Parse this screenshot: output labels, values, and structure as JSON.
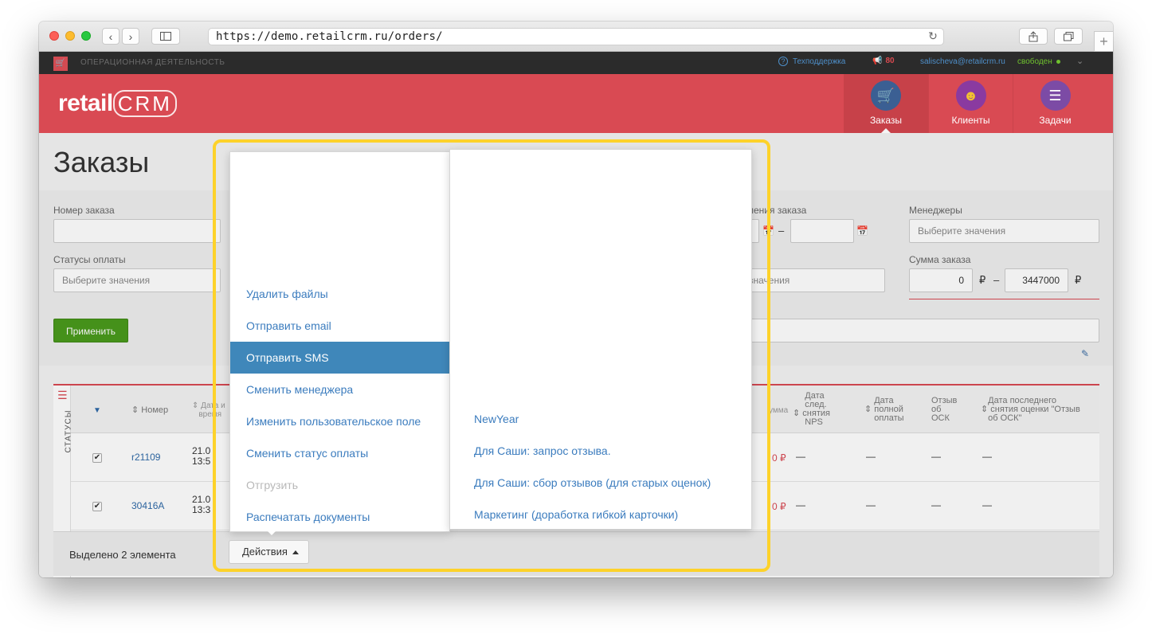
{
  "browser": {
    "url": "https://demo.retailcrm.ru/orders/"
  },
  "topbar": {
    "section_title": "ОПЕРАЦИОННАЯ ДЕЯТЕЛЬНОСТЬ",
    "support_label": "Техподдержка",
    "notifications_count": "80",
    "user_email": "salischeva@retailcrm.ru",
    "user_status": "свободен"
  },
  "header": {
    "logo_text": "retail",
    "logo_crm": "CRM",
    "nav": [
      {
        "label": "Заказы",
        "icon": "cart-icon",
        "active": true
      },
      {
        "label": "Клиенты",
        "icon": "user-icon",
        "active": false
      },
      {
        "label": "Задачи",
        "icon": "tasks-icon",
        "active": false
      }
    ]
  },
  "page": {
    "title": "Заказы"
  },
  "filters": {
    "order_number_label": "Номер заказа",
    "date_label_fragment": "ления заказа",
    "managers_label": "Менеджеры",
    "managers_placeholder": "Выберите значения",
    "payment_status_label": "Статусы оплаты",
    "payment_status_placeholder": "Выберите значения",
    "mid_placeholder_fragment": "значения",
    "sum_label": "Сумма заказа",
    "sum_from": "0",
    "sum_to": "3447000",
    "currency": "₽",
    "dash": "–",
    "apply_label": "Применить"
  },
  "table": {
    "side_label": "СТАТУСЫ",
    "headers": {
      "number": "Номер",
      "date_frag_1": "Дата и",
      "date_frag_2": "время",
      "sum_frag": "умма",
      "nps_1": "Дата",
      "nps_2": "след.",
      "nps_3": "снятия",
      "nps_4": "NPS",
      "pay_1": "Дата",
      "pay_2": "полной",
      "pay_3": "оплаты",
      "osk_1": "Отзыв",
      "osk_2": "об",
      "osk_3": "ОСК",
      "last_1": "Дата последнего",
      "last_2": "снятия оценки \"Отзыв",
      "last_3": "об ОСК\""
    },
    "rows": [
      {
        "number": "r21109",
        "date1": "21.0",
        "date2": "13:5",
        "sum": "0 ₽",
        "nps": "—",
        "pay": "—",
        "osk": "—",
        "last": "—",
        "checked": true
      },
      {
        "number": "30416A",
        "date1": "21.0",
        "date2": "13:3",
        "sum": "0 ₽",
        "nps": "—",
        "pay": "—",
        "osk": "—",
        "last": "—",
        "checked": true
      }
    ]
  },
  "selection": {
    "text": "Выделено 2 элемента"
  },
  "actions_menu": {
    "button_label": "Действия",
    "items": [
      {
        "label": "Удалить файлы",
        "state": "normal"
      },
      {
        "label": "Отправить email",
        "state": "normal"
      },
      {
        "label": "Отправить SMS",
        "state": "active"
      },
      {
        "label": "Сменить менеджера",
        "state": "normal"
      },
      {
        "label": "Изменить пользовательское поле",
        "state": "normal"
      },
      {
        "label": "Сменить статус оплаты",
        "state": "normal"
      },
      {
        "label": "Отгрузить",
        "state": "disabled"
      },
      {
        "label": "Распечатать документы",
        "state": "normal"
      }
    ],
    "sms_templates": [
      "NewYear",
      "Для Саши: запрос отзыва.",
      "Для Саши: сбор отзывов (для старых оценок)",
      "Маркетинг (доработка гибкой карточки)"
    ]
  },
  "colors": {
    "brand_red": "#d94a53",
    "highlight": "#fdd22a",
    "active_item": "#3f87ba",
    "link": "#3b7cbe"
  }
}
